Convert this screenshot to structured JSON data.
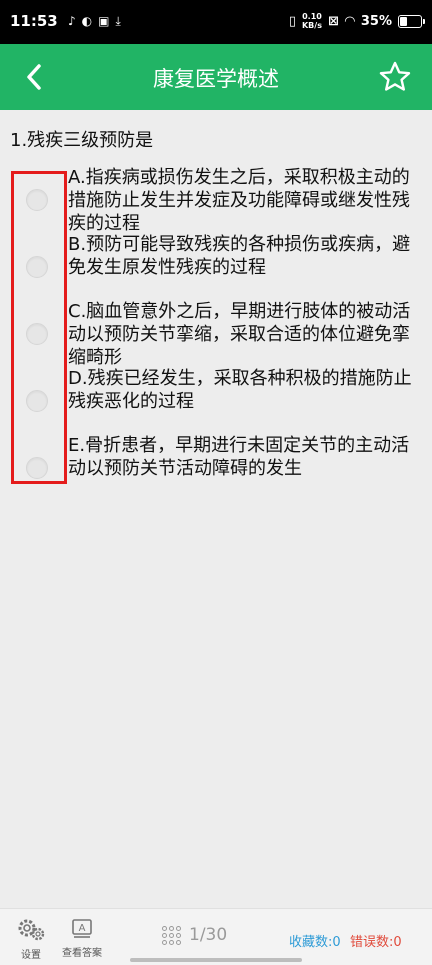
{
  "status_bar": {
    "time": "11:53",
    "net_speed_value": "0.10",
    "net_speed_unit": "KB/s",
    "battery": "35%",
    "battery_level": 0.35
  },
  "header": {
    "title": "康复医学概述",
    "back_icon": "chevron-left-icon",
    "star_icon": "star-outline-icon"
  },
  "question": {
    "text": "1.残疾三级预防是",
    "options": [
      {
        "label": "A.指疾病或损伤发生之后，采取积极主动的措施防止发生并发症及功能障碍或继发性残疾的过程"
      },
      {
        "label": "B.预防可能导致残疾的各种损伤或疾病，避免发生原发性残疾的过程"
      },
      {
        "label": "C.脑血管意外之后，早期进行肢体的被动活动以预防关节挛缩，采取合适的体位避免挛缩畸形"
      },
      {
        "label": "D.残疾已经发生，采取各种积极的措施防止残疾恶化的过程"
      },
      {
        "label": "E.骨折患者，早期进行未固定关节的主动活动以预防关节活动障碍的发生"
      }
    ]
  },
  "bottom_bar": {
    "settings_label": "设置",
    "answer_label": "查看答案",
    "page": "1/30",
    "collect": "收藏数:0",
    "wrong": "错误数:0"
  },
  "colors": {
    "header": "#21b465",
    "highlight": "#e41c1c",
    "collect": "#2e9bd6",
    "wrong": "#e04b3c"
  }
}
